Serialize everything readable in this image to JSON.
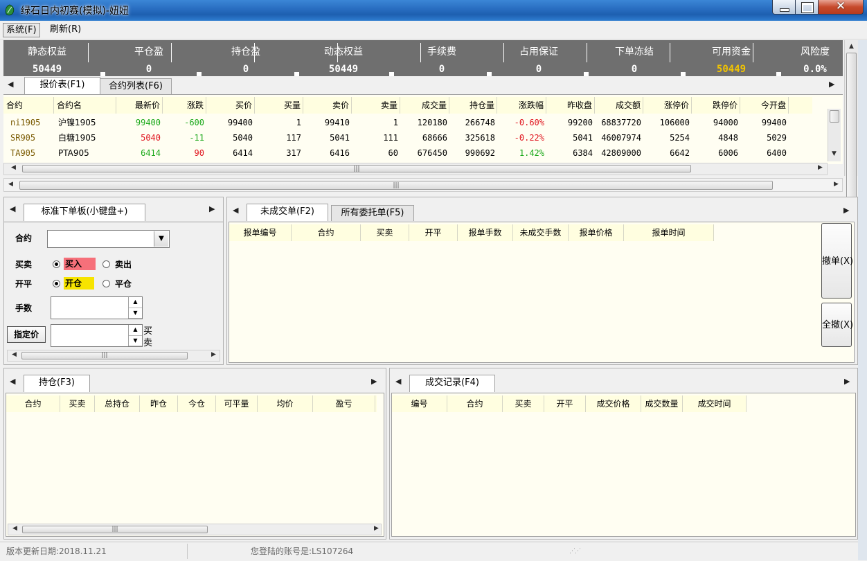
{
  "window": {
    "title": "绿石日内初赛(模拟)-妞妞",
    "close_glyph": "✕"
  },
  "menu": {
    "items": [
      "系统(F)",
      "刷新(R)"
    ]
  },
  "summary": [
    {
      "label": "静态权益",
      "value": "50449"
    },
    {
      "label": "平仓盈",
      "value": "0"
    },
    {
      "label": "持仓盈",
      "value": "0"
    },
    {
      "label": "动态权益",
      "value": "50449"
    },
    {
      "label": "手续费",
      "value": "0"
    },
    {
      "label": "占用保证",
      "value": "0"
    },
    {
      "label": "下单冻结",
      "value": "0"
    },
    {
      "label": "可用资金",
      "value": "50449"
    },
    {
      "label": "风险度",
      "value": "0.0%"
    }
  ],
  "quote_tabs": [
    "报价表(F1)",
    "合约列表(F6)"
  ],
  "quote_table": {
    "columns": [
      "合约",
      "合约名",
      "最新价",
      "涨跌",
      "买价",
      "买量",
      "卖价",
      "卖量",
      "成交量",
      "持仓量",
      "涨跌幅",
      "昨收盘",
      "成交额",
      "涨停价",
      "跌停价",
      "今开盘"
    ],
    "rows": [
      [
        "ni1905",
        "沪镍1905",
        "99400",
        "-600",
        "99400",
        "1",
        "99410",
        "1",
        "120180",
        "266748",
        "-0.60%",
        "99200",
        "68837720",
        "106000",
        "94000",
        "99400"
      ],
      [
        "SR905",
        "白糖1905",
        "5040",
        "-11",
        "5040",
        "117",
        "5041",
        "111",
        "68666",
        "325618",
        "-0.22%",
        "5041",
        "46007974",
        "5254",
        "4848",
        "5029"
      ],
      [
        "TA905",
        "PTA905",
        "6414",
        "90",
        "6414",
        "317",
        "6416",
        "60",
        "676450",
        "990692",
        "1.42%",
        "6384",
        "42809000",
        "6642",
        "6006",
        "6400"
      ]
    ]
  },
  "order_panel": {
    "tab": "标准下单板(小键盘+)",
    "contract_label": "合约",
    "direction_label": "买卖",
    "buy": "买入",
    "sell": "卖出",
    "offset_label": "开平",
    "open": "开仓",
    "close": "平仓",
    "qty_label": "手数",
    "price_label": "指定价",
    "side_buy": "买",
    "side_sell": "卖"
  },
  "pending_tabs": [
    "未成交单(F2)",
    "所有委托单(F5)"
  ],
  "pending_columns": [
    "报单编号",
    "合约",
    "买卖",
    "开平",
    "报单手数",
    "未成交手数",
    "报单价格",
    "报单时间"
  ],
  "cancel_buttons": [
    "撤单(X)",
    "全撤(X)"
  ],
  "position_tab": "持仓(F3)",
  "position_columns": [
    "合约",
    "买卖",
    "总持仓",
    "昨仓",
    "今仓",
    "可平量",
    "均价",
    "盈亏"
  ],
  "trade_tab": "成交记录(F4)",
  "trade_columns": [
    "编号",
    "合约",
    "买卖",
    "开平",
    "成交价格",
    "成交数量",
    "成交时间"
  ],
  "status": {
    "version": "版本更新日期:2018.11.21",
    "account": "您登陆的账号是:LS107264"
  },
  "colors": {
    "up": "#e0141e",
    "down": "#1aa81a",
    "buy_bg": "#f6707a",
    "open_bg": "#f7e400",
    "equity_gold": "#f2c400"
  }
}
